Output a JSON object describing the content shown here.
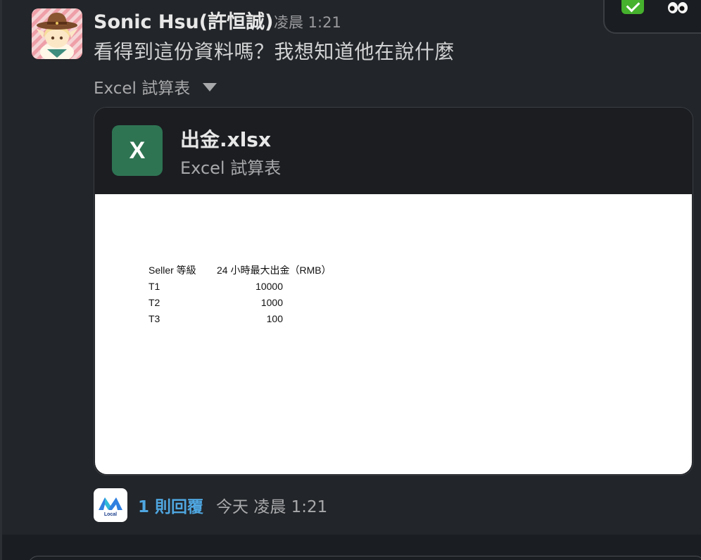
{
  "message": {
    "sender": "Sonic Hsu(許恒誠)",
    "time": "凌晨 1:21",
    "text": "看得到這份資料嗎？我想知道他在說什麼"
  },
  "attachment": {
    "type_label": "Excel 試算表",
    "icon_letter": "X",
    "file_name": "出金.xlsx",
    "file_type": "Excel 試算表",
    "preview": {
      "header": [
        "Seller 等級",
        "24 小時最大出金（RMB）"
      ],
      "rows": [
        [
          "T1",
          "10000"
        ],
        [
          "T2",
          "1000"
        ],
        [
          "T3",
          "100"
        ]
      ]
    }
  },
  "thread": {
    "reply_count": "1 則回覆",
    "reply_time": "今天 凌晨 1:21",
    "app_label": "Local"
  },
  "colors": {
    "background": "#1a1d21",
    "message_bg": "#222529",
    "excel_green": "#2e7453",
    "link_blue": "#4fa6e0",
    "check_green": "#45b12d"
  },
  "reactions": [
    "white-check-mark-icon",
    "eyes-icon"
  ]
}
